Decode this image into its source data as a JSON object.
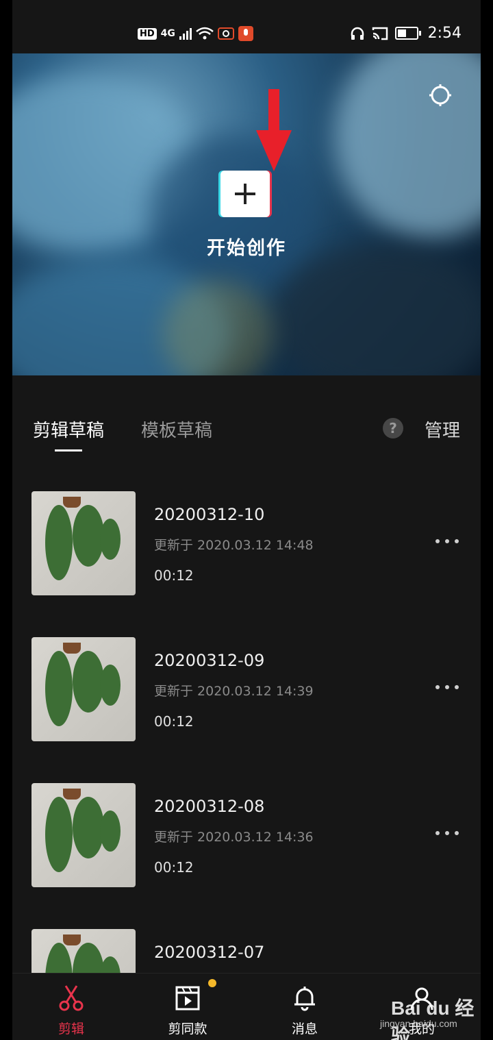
{
  "status_bar": {
    "hd": "HD",
    "network": "4G",
    "time": "2:54"
  },
  "hero": {
    "create_label": "开始创作"
  },
  "tabs": {
    "items": [
      {
        "label": "剪辑草稿",
        "active": true
      },
      {
        "label": "模板草稿",
        "active": false
      }
    ],
    "help_label": "?",
    "manage_label": "管理"
  },
  "drafts": [
    {
      "title": "20200312-10",
      "updated": "更新于 2020.03.12 14:48",
      "duration": "00:12"
    },
    {
      "title": "20200312-09",
      "updated": "更新于 2020.03.12 14:39",
      "duration": "00:12"
    },
    {
      "title": "20200312-08",
      "updated": "更新于 2020.03.12 14:36",
      "duration": "00:12"
    },
    {
      "title": "20200312-07",
      "updated": "",
      "duration": ""
    }
  ],
  "nav": {
    "items": [
      {
        "label": "剪辑",
        "icon": "scissors-icon",
        "active": true
      },
      {
        "label": "剪同款",
        "icon": "clapperboard-icon",
        "active": false,
        "badge": true
      },
      {
        "label": "消息",
        "icon": "bell-icon",
        "active": false
      },
      {
        "label": "我的",
        "icon": "profile-icon",
        "active": false
      }
    ]
  },
  "watermark": {
    "brand": "Bai du 经验",
    "url": "jingyan.baidu.com"
  },
  "colors": {
    "accent": "#e8344c",
    "badge": "#f4b82a",
    "annotation_arrow": "#e8202a"
  }
}
